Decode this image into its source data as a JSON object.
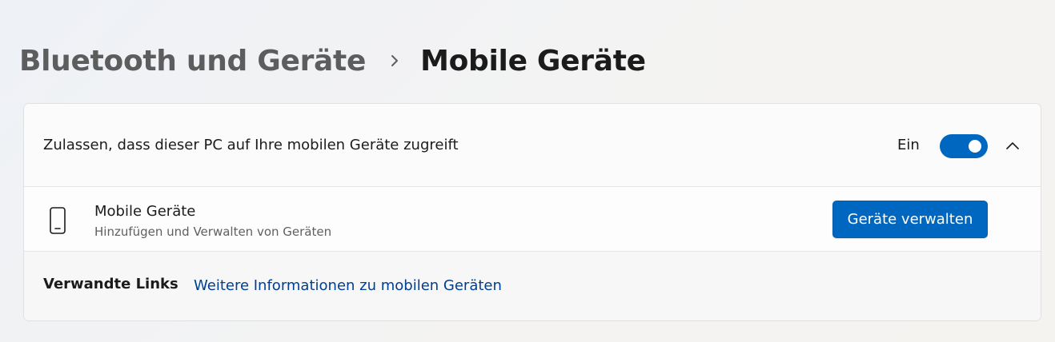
{
  "breadcrumb": {
    "parent": "Bluetooth und Geräte",
    "current": "Mobile Geräte"
  },
  "access_setting": {
    "label": "Zulassen, dass dieser PC auf Ihre mobilen Geräte zugreift",
    "toggle_state": "Ein",
    "toggle_on": true
  },
  "device_row": {
    "title": "Mobile Geräte",
    "subtitle": "Hinzufügen und Verwalten von Geräten",
    "button_label": "Geräte verwalten"
  },
  "related_links": {
    "label": "Verwandte Links",
    "link": "Weitere Informationen zu mobilen Geräten"
  },
  "icons": {
    "breadcrumb_separator": "chevron-right-icon",
    "collapse": "chevron-up-icon",
    "device": "smartphone-icon"
  },
  "colors": {
    "accent": "#0067c0",
    "link": "#003e92"
  }
}
